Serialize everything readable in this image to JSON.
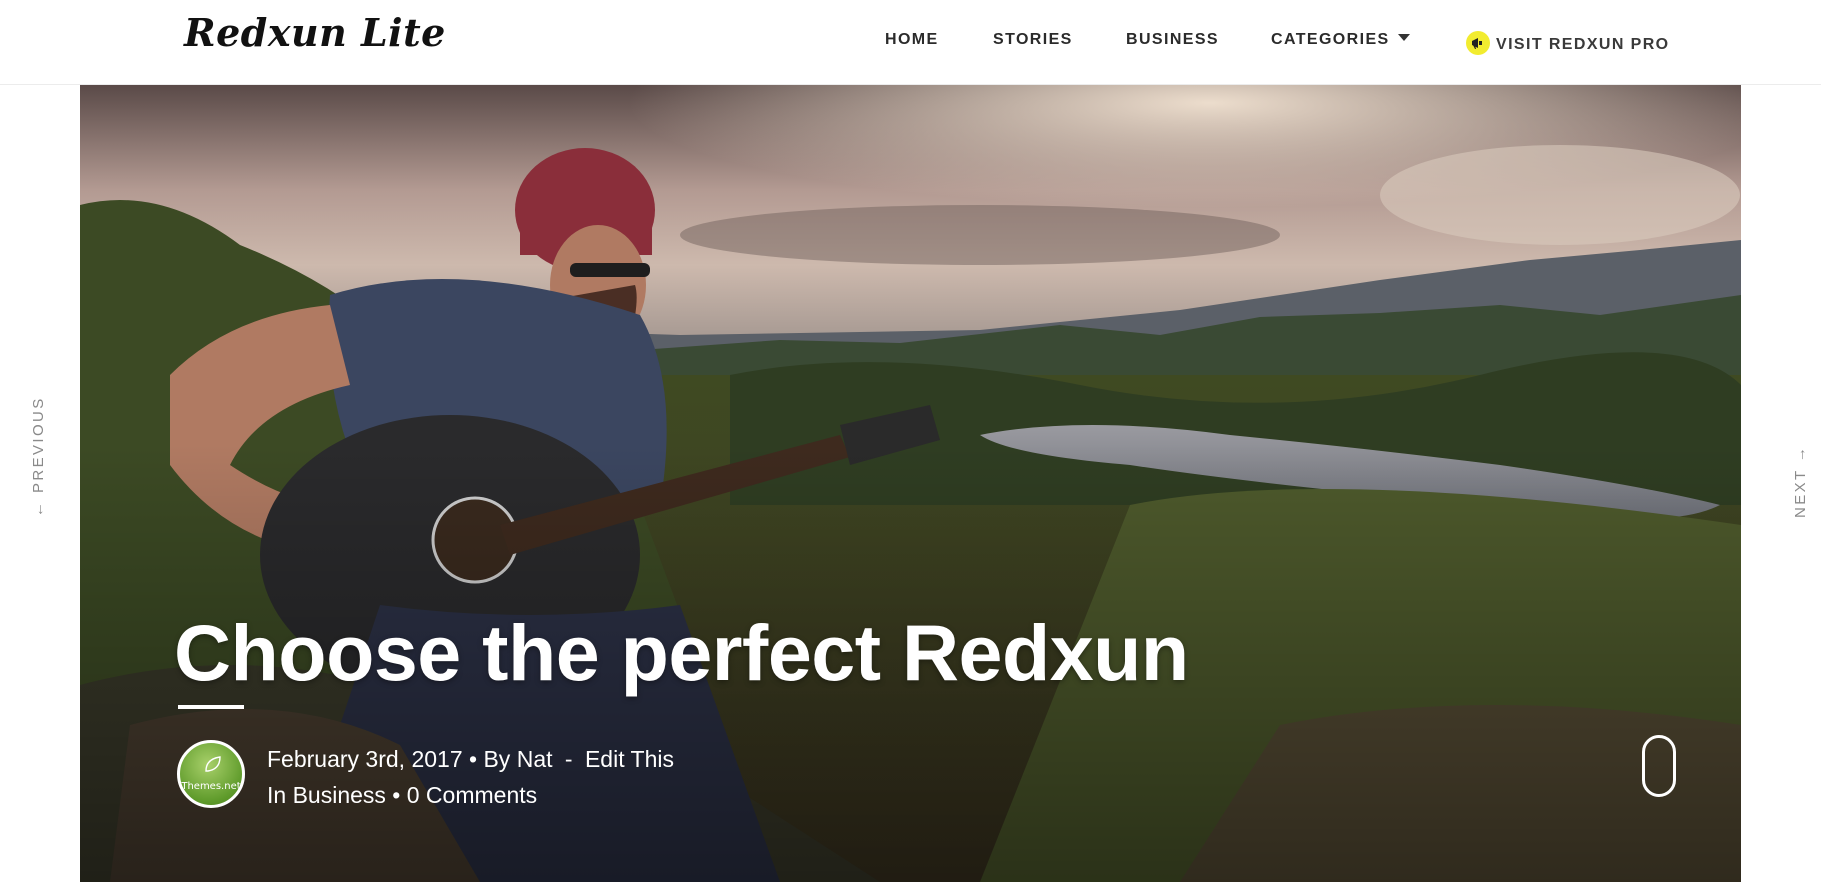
{
  "site": {
    "logo": "Redxun Lite"
  },
  "nav": {
    "items": [
      {
        "label": "HOME"
      },
      {
        "label": "STORIES"
      },
      {
        "label": "BUSINESS"
      },
      {
        "label": "CATEGORIES"
      },
      {
        "label": "VISIT REDXUN PRO"
      }
    ]
  },
  "pager": {
    "previous": "← PREVIOUS",
    "next": "NEXT →"
  },
  "post": {
    "title": "Choose the perfect Redxun",
    "date": "February 3rd, 2017",
    "by_prefix": "• By",
    "author": "Nat",
    "separator": "-",
    "edit": "Edit This",
    "in_prefix": "In",
    "category": "Business",
    "comments_sep": "•",
    "comments": "0 Comments",
    "avatar_text": "Themes.net"
  },
  "colors": {
    "accent_yellow": "#f2ec2f",
    "header_bg": "#ffffff",
    "nav_text": "#2b2b2b"
  },
  "icons": {
    "megaphone": "megaphone-icon",
    "caret": "caret-down-icon",
    "scroll": "mouse-scroll-icon"
  }
}
